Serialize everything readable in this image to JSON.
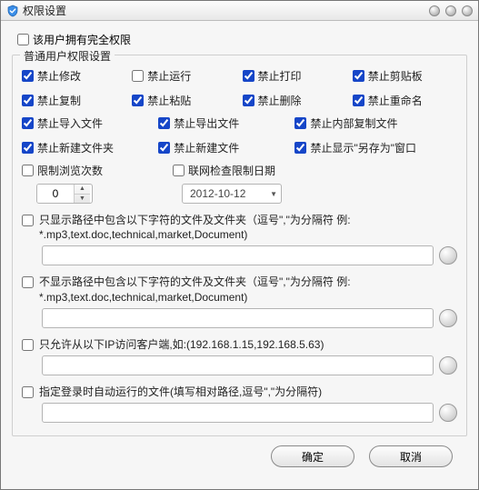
{
  "window": {
    "title": "权限设置"
  },
  "topcheck": {
    "label": "该用户拥有完全权限",
    "checked": false
  },
  "fieldset": {
    "legend": "普通用户权限设置"
  },
  "perm": {
    "modify": {
      "label": "禁止修改",
      "checked": true
    },
    "run": {
      "label": "禁止运行",
      "checked": false
    },
    "print": {
      "label": "禁止打印",
      "checked": true
    },
    "clip": {
      "label": "禁止剪贴板",
      "checked": true
    },
    "copy": {
      "label": "禁止复制",
      "checked": true
    },
    "paste": {
      "label": "禁止粘贴",
      "checked": true
    },
    "delete": {
      "label": "禁止删除",
      "checked": true
    },
    "rename": {
      "label": "禁止重命名",
      "checked": true
    },
    "importf": {
      "label": "禁止导入文件",
      "checked": true
    },
    "exportf": {
      "label": "禁止导出文件",
      "checked": true
    },
    "intcopy": {
      "label": "禁止内部复制文件",
      "checked": true
    },
    "newdir": {
      "label": "禁止新建文件夹",
      "checked": true
    },
    "newfile": {
      "label": "禁止新建文件",
      "checked": true
    },
    "saveas": {
      "label": "禁止显示\"另存为\"窗口",
      "checked": true
    }
  },
  "limitview": {
    "label": "限制浏览次数",
    "checked": false,
    "value": "0"
  },
  "netcheck": {
    "label": "联网检查限制日期",
    "checked": false,
    "date": "2012-10-12"
  },
  "filter_show": {
    "checked": false,
    "label": "只显示路径中包含以下字符的文件及文件夹（逗号\",\"为分隔符 例: *.mp3,text.doc,technical,market,Document)",
    "value": ""
  },
  "filter_hide": {
    "checked": false,
    "label": "不显示路径中包含以下字符的文件及文件夹（逗号\",\"为分隔符 例: *.mp3,text.doc,technical,market,Document)",
    "value": ""
  },
  "ip_allow": {
    "checked": false,
    "label": "只允许从以下IP访问客户端,如:(192.168.1.15,192.168.5.63)",
    "value": ""
  },
  "autorun": {
    "checked": false,
    "label": "指定登录时自动运行的文件(填写相对路径,逗号\",\"为分隔符)",
    "value": ""
  },
  "buttons": {
    "ok": "确定",
    "cancel": "取消"
  }
}
